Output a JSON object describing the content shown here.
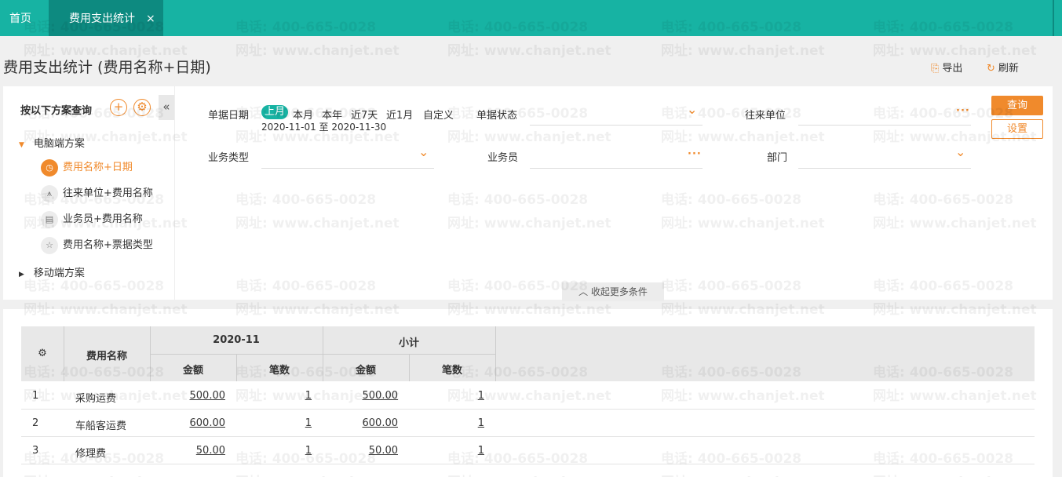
{
  "tabs": {
    "home": "首页",
    "active": "费用支出统计",
    "close": "×"
  },
  "page": {
    "title": "费用支出统计 (费用名称+日期)",
    "export": "导出",
    "refresh": "刷新"
  },
  "sidebar": {
    "title": "按以下方案查询",
    "add": "+",
    "collapse": "«",
    "groups": [
      {
        "label": "电脑端方案",
        "caret": "▼"
      },
      {
        "label": "移动端方案",
        "caret": "▶"
      }
    ],
    "items": [
      {
        "label": "费用名称+日期"
      },
      {
        "label": "往来单位+费用名称"
      },
      {
        "label": "业务员+费用名称"
      },
      {
        "label": "费用名称+票据类型"
      }
    ]
  },
  "filters": {
    "date_label": "单据日期",
    "date_options": [
      "上月",
      "本月",
      "本年",
      "近7天",
      "近1月",
      "自定义"
    ],
    "date_range": "2020-11-01 至 2020-11-30",
    "status_label": "单据状态",
    "partner_label": "往来单位",
    "biz_type_label": "业务类型",
    "salesman_label": "业务员",
    "dept_label": "部门",
    "query_button": "查询",
    "settings_button": "设置",
    "more_toggle": "收起更多条件"
  },
  "table": {
    "header_name": "费用名称",
    "group1": "2020-11",
    "group2": "小计",
    "amount": "金额",
    "count": "笔数",
    "rows": [
      {
        "idx": "1",
        "name": "采购运费",
        "amount": "500.00",
        "count": "1",
        "sub_amount": "500.00",
        "sub_count": "1"
      },
      {
        "idx": "2",
        "name": "车船客运费",
        "amount": "600.00",
        "count": "1",
        "sub_amount": "600.00",
        "sub_count": "1"
      },
      {
        "idx": "3",
        "name": "修理费",
        "amount": "50.00",
        "count": "1",
        "sub_amount": "50.00",
        "sub_count": "1"
      }
    ]
  },
  "watermark": {
    "phone": "电话: 400-665-0028",
    "site": "网址: www.chanjet.net"
  },
  "colors": {
    "teal": "#17b3a3",
    "dark_teal": "#0d8a80",
    "orange": "#f08a2c"
  }
}
